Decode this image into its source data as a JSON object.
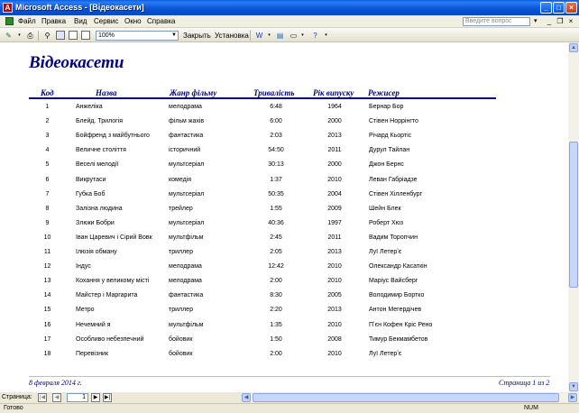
{
  "window": {
    "title": "Microsoft Access - [Відеокасети]"
  },
  "menu": {
    "items": [
      "Файл",
      "Правка",
      "Вид",
      "Сервис",
      "Окно",
      "Справка"
    ],
    "help_placeholder": "Введите вопрос"
  },
  "toolbar": {
    "zoom": "100%",
    "close_label": "Закрыть",
    "setup_label": "Установка"
  },
  "report": {
    "title": "Відеокасети",
    "columns": [
      "Код",
      "Назва",
      "Жанр фільму",
      "Тривалість",
      "Рік випуску",
      "Режисер"
    ],
    "rows": [
      [
        "1",
        "Анжеліка",
        "мелодрама",
        "6:48",
        "1964",
        "Бернар Бор"
      ],
      [
        "2",
        "Блейд. Трилогія",
        "фільм жахів",
        "6:00",
        "2000",
        "Стівен Норрінгто"
      ],
      [
        "3",
        "Бойфренд з майбутнього",
        "фантастика",
        "2:03",
        "2013",
        "Річард Кьортіс"
      ],
      [
        "4",
        "Величне століття",
        "історичний",
        "54:50",
        "2011",
        "Дурул Тайлан"
      ],
      [
        "5",
        "Веселі мелодії",
        "мультсеріал",
        "30:13",
        "2000",
        "Джон Бернс"
      ],
      [
        "6",
        "Викрутаси",
        "комедія",
        "1:37",
        "2010",
        "Леван Габріадзе"
      ],
      [
        "7",
        "Губка Боб",
        "мультсеріал",
        "50:35",
        "2004",
        "Стівен Хілленбург"
      ],
      [
        "8",
        "Залізна людина",
        "трейлер",
        "1:55",
        "2009",
        "Шейн Блек"
      ],
      [
        "9",
        "Злюки Бобри",
        "мультсеріал",
        "40:36",
        "1997",
        "Роберт Хюз"
      ],
      [
        "10",
        "Іван Царевич і Сірий Вовк",
        "мультфільм",
        "2:45",
        "2011",
        "Вадим Торопчин"
      ],
      [
        "11",
        "Ілюзія обману",
        "триллер",
        "2:05",
        "2013",
        "Луї Летерʼє"
      ],
      [
        "12",
        "Індус",
        "мелодрама",
        "12:42",
        "2010",
        "Олександр Касаткін"
      ],
      [
        "13",
        "Кохання у великому місті",
        "мелодрама",
        "2:00",
        "2010",
        "Маріус Вайсберг"
      ],
      [
        "14",
        "Майстер і Маргарита",
        "фантастика",
        "8:30",
        "2005",
        "Володимир Бортко"
      ],
      [
        "15",
        "Метро",
        "триллер",
        "2:20",
        "2013",
        "Антон Мегердічев"
      ],
      [
        "16",
        "Нечемний я",
        "мультфільм",
        "1:35",
        "2010",
        "Пʼєн Кофен Кріс Рено"
      ],
      [
        "17",
        "Особливо небезпечний",
        "бойовик",
        "1:50",
        "2008",
        "Тимур Бекмамбетов"
      ],
      [
        "18",
        "Перевізник",
        "бойовик",
        "2:00",
        "2010",
        "Луї Летерʼє"
      ]
    ],
    "footer_date": "8 февраля 2014 г.",
    "footer_page": "Страница 1 из 2"
  },
  "nav": {
    "label": "Страница:",
    "page": "1"
  },
  "status": {
    "text": "Готово",
    "num": "NUM"
  }
}
